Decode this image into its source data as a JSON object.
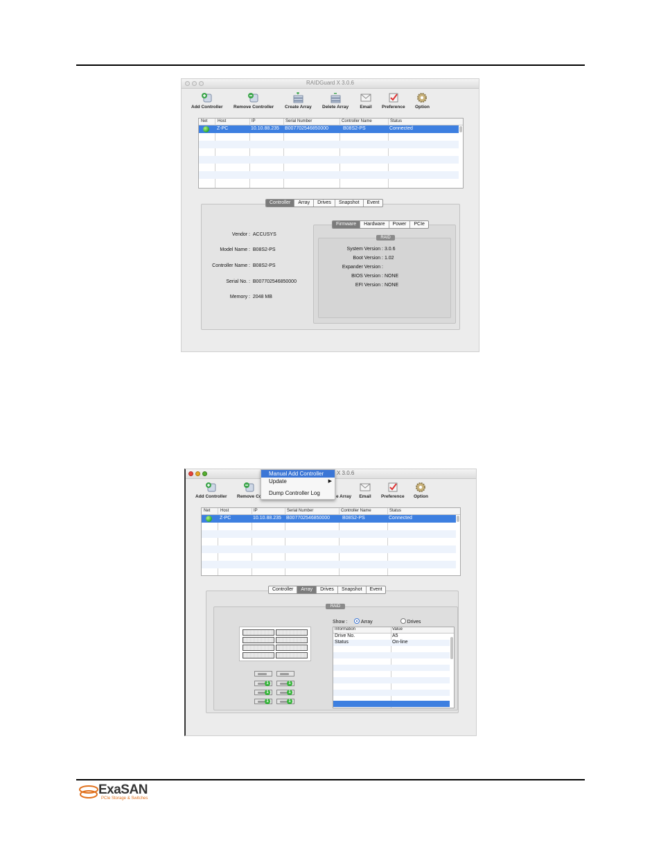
{
  "brand": {
    "name": "ExaSAN",
    "tagline": "PCIe Storage & Switches"
  },
  "window1": {
    "title": "RAIDGuard X 3.0.6",
    "toolbar": [
      {
        "label": "Add Controller",
        "icon": "add-controller-icon"
      },
      {
        "label": "Remove Controller",
        "icon": "remove-controller-icon"
      },
      {
        "label": "Create Array",
        "icon": "create-array-icon"
      },
      {
        "label": "Delete Array",
        "icon": "delete-array-icon"
      },
      {
        "label": "Email",
        "icon": "email-icon"
      },
      {
        "label": "Preference",
        "icon": "preference-icon"
      },
      {
        "label": "Option",
        "icon": "option-gear-icon"
      }
    ],
    "table": {
      "headers": [
        "Net",
        "Host",
        "IP",
        "Serial Number",
        "Controller Name",
        "Status"
      ],
      "rows": [
        {
          "host": "Z-PC",
          "ip": "10.10.88.235",
          "serial": "B007702546850000",
          "controller": "B08S2-PS",
          "status": "Connected"
        }
      ]
    },
    "tabs": [
      "Controller",
      "Array",
      "Drives",
      "Snapshot",
      "Event"
    ],
    "active_tab": "Controller",
    "info": {
      "vendor_label": "Vendor :",
      "vendor": "ACCUSYS",
      "model_label": "Model Name :",
      "model": "B08S2-PS",
      "controller_label": "Controller Name :",
      "controller": "B08S2-PS",
      "serial_label": "Serial No. :",
      "serial": "B007702546850000",
      "memory_label": "Memory :",
      "memory": "2048 MB"
    },
    "subtabs": [
      "Firmware",
      "Hardware",
      "Power",
      "PCIe"
    ],
    "active_subtab": "Firmware",
    "raid_label": "RAID",
    "firmware": {
      "system_label": "System Version :",
      "system": "3.0.6",
      "boot_label": "Boot Version :",
      "boot": "1.02",
      "expander_label": "Expander Version :",
      "expander": "",
      "bios_label": "BIOS Version :",
      "bios": "NONE",
      "efi_label": "EFI Version :",
      "efi": "NONE"
    }
  },
  "window2": {
    "title_suffix": "X 3.0.6",
    "toolbar": {
      "add": "Add Controller",
      "remove": "Remove Co",
      "array": "e Array",
      "email": "Email",
      "preference": "Preference",
      "option": "Option"
    },
    "menu": {
      "items": [
        "Manual Add Controller",
        "Update",
        "Dump Controller Log"
      ]
    },
    "table": {
      "headers": [
        "Net",
        "Host",
        "IP",
        "Serial Number",
        "Controller Name",
        "Status"
      ],
      "rows": [
        {
          "host": "Z-PC",
          "ip": "10.10.88.235",
          "serial": "B007702546850000",
          "controller": "B08S2-PS",
          "status": "Connected"
        }
      ]
    },
    "tabs": [
      "Controller",
      "Array",
      "Drives",
      "Snapshot",
      "Event"
    ],
    "active_tab": "Array",
    "raid_label": "RAID",
    "show_label": "Show :",
    "show_options": [
      "Array",
      "Drives"
    ],
    "show_selected": "Array",
    "info_table": {
      "headers": [
        "Information",
        "Value"
      ],
      "rows": [
        [
          "Drive No.",
          "A5"
        ],
        [
          "Status",
          "On-line"
        ]
      ]
    },
    "drive_badges": [
      "1",
      "1",
      "1",
      "1",
      "1",
      "1"
    ]
  },
  "colors": {
    "selection": "#3d7fe0",
    "status_ok": "#36b43a",
    "brand_orange": "#e0701c"
  }
}
